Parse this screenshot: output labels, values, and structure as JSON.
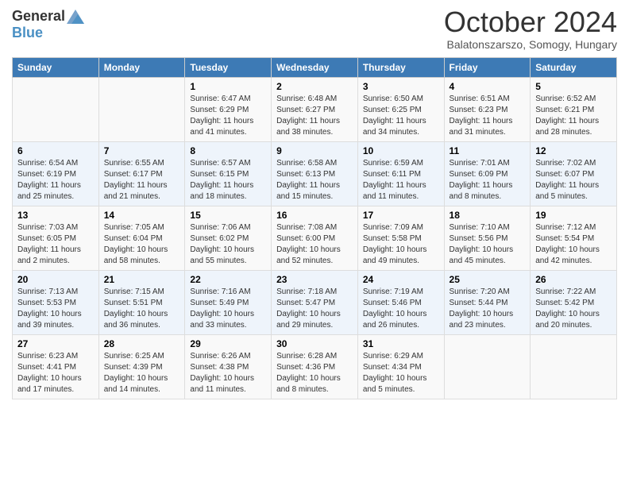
{
  "header": {
    "logo_general": "General",
    "logo_blue": "Blue",
    "month_title": "October 2024",
    "location": "Balatonszarszo, Somogy, Hungary"
  },
  "calendar": {
    "weekdays": [
      "Sunday",
      "Monday",
      "Tuesday",
      "Wednesday",
      "Thursday",
      "Friday",
      "Saturday"
    ],
    "weeks": [
      [
        {
          "day": "",
          "info": ""
        },
        {
          "day": "",
          "info": ""
        },
        {
          "day": "1",
          "info": "Sunrise: 6:47 AM\nSunset: 6:29 PM\nDaylight: 11 hours and 41 minutes."
        },
        {
          "day": "2",
          "info": "Sunrise: 6:48 AM\nSunset: 6:27 PM\nDaylight: 11 hours and 38 minutes."
        },
        {
          "day": "3",
          "info": "Sunrise: 6:50 AM\nSunset: 6:25 PM\nDaylight: 11 hours and 34 minutes."
        },
        {
          "day": "4",
          "info": "Sunrise: 6:51 AM\nSunset: 6:23 PM\nDaylight: 11 hours and 31 minutes."
        },
        {
          "day": "5",
          "info": "Sunrise: 6:52 AM\nSunset: 6:21 PM\nDaylight: 11 hours and 28 minutes."
        }
      ],
      [
        {
          "day": "6",
          "info": "Sunrise: 6:54 AM\nSunset: 6:19 PM\nDaylight: 11 hours and 25 minutes."
        },
        {
          "day": "7",
          "info": "Sunrise: 6:55 AM\nSunset: 6:17 PM\nDaylight: 11 hours and 21 minutes."
        },
        {
          "day": "8",
          "info": "Sunrise: 6:57 AM\nSunset: 6:15 PM\nDaylight: 11 hours and 18 minutes."
        },
        {
          "day": "9",
          "info": "Sunrise: 6:58 AM\nSunset: 6:13 PM\nDaylight: 11 hours and 15 minutes."
        },
        {
          "day": "10",
          "info": "Sunrise: 6:59 AM\nSunset: 6:11 PM\nDaylight: 11 hours and 11 minutes."
        },
        {
          "day": "11",
          "info": "Sunrise: 7:01 AM\nSunset: 6:09 PM\nDaylight: 11 hours and 8 minutes."
        },
        {
          "day": "12",
          "info": "Sunrise: 7:02 AM\nSunset: 6:07 PM\nDaylight: 11 hours and 5 minutes."
        }
      ],
      [
        {
          "day": "13",
          "info": "Sunrise: 7:03 AM\nSunset: 6:05 PM\nDaylight: 11 hours and 2 minutes."
        },
        {
          "day": "14",
          "info": "Sunrise: 7:05 AM\nSunset: 6:04 PM\nDaylight: 10 hours and 58 minutes."
        },
        {
          "day": "15",
          "info": "Sunrise: 7:06 AM\nSunset: 6:02 PM\nDaylight: 10 hours and 55 minutes."
        },
        {
          "day": "16",
          "info": "Sunrise: 7:08 AM\nSunset: 6:00 PM\nDaylight: 10 hours and 52 minutes."
        },
        {
          "day": "17",
          "info": "Sunrise: 7:09 AM\nSunset: 5:58 PM\nDaylight: 10 hours and 49 minutes."
        },
        {
          "day": "18",
          "info": "Sunrise: 7:10 AM\nSunset: 5:56 PM\nDaylight: 10 hours and 45 minutes."
        },
        {
          "day": "19",
          "info": "Sunrise: 7:12 AM\nSunset: 5:54 PM\nDaylight: 10 hours and 42 minutes."
        }
      ],
      [
        {
          "day": "20",
          "info": "Sunrise: 7:13 AM\nSunset: 5:53 PM\nDaylight: 10 hours and 39 minutes."
        },
        {
          "day": "21",
          "info": "Sunrise: 7:15 AM\nSunset: 5:51 PM\nDaylight: 10 hours and 36 minutes."
        },
        {
          "day": "22",
          "info": "Sunrise: 7:16 AM\nSunset: 5:49 PM\nDaylight: 10 hours and 33 minutes."
        },
        {
          "day": "23",
          "info": "Sunrise: 7:18 AM\nSunset: 5:47 PM\nDaylight: 10 hours and 29 minutes."
        },
        {
          "day": "24",
          "info": "Sunrise: 7:19 AM\nSunset: 5:46 PM\nDaylight: 10 hours and 26 minutes."
        },
        {
          "day": "25",
          "info": "Sunrise: 7:20 AM\nSunset: 5:44 PM\nDaylight: 10 hours and 23 minutes."
        },
        {
          "day": "26",
          "info": "Sunrise: 7:22 AM\nSunset: 5:42 PM\nDaylight: 10 hours and 20 minutes."
        }
      ],
      [
        {
          "day": "27",
          "info": "Sunrise: 6:23 AM\nSunset: 4:41 PM\nDaylight: 10 hours and 17 minutes."
        },
        {
          "day": "28",
          "info": "Sunrise: 6:25 AM\nSunset: 4:39 PM\nDaylight: 10 hours and 14 minutes."
        },
        {
          "day": "29",
          "info": "Sunrise: 6:26 AM\nSunset: 4:38 PM\nDaylight: 10 hours and 11 minutes."
        },
        {
          "day": "30",
          "info": "Sunrise: 6:28 AM\nSunset: 4:36 PM\nDaylight: 10 hours and 8 minutes."
        },
        {
          "day": "31",
          "info": "Sunrise: 6:29 AM\nSunset: 4:34 PM\nDaylight: 10 hours and 5 minutes."
        },
        {
          "day": "",
          "info": ""
        },
        {
          "day": "",
          "info": ""
        }
      ]
    ]
  }
}
